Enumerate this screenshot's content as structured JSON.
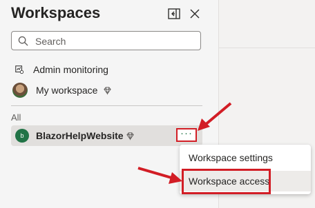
{
  "panel": {
    "title": "Workspaces",
    "search": {
      "placeholder": "Search",
      "value": ""
    },
    "nav": [
      {
        "label": "Admin monitoring",
        "icon": "admin-monitoring-icon"
      },
      {
        "label": "My workspace",
        "icon": "avatar",
        "badge_icon": "premium-diamond-icon"
      }
    ],
    "section_label": "All",
    "workspace": {
      "initial": "b",
      "name": "BlazorHelpWebsite",
      "badge_icon": "premium-diamond-icon",
      "more_label": "···"
    }
  },
  "context_menu": {
    "items": [
      {
        "label": "Workspace settings"
      },
      {
        "label": "Workspace access"
      }
    ]
  },
  "colors": {
    "accent": "#217346",
    "annotation": "#d21d25"
  }
}
